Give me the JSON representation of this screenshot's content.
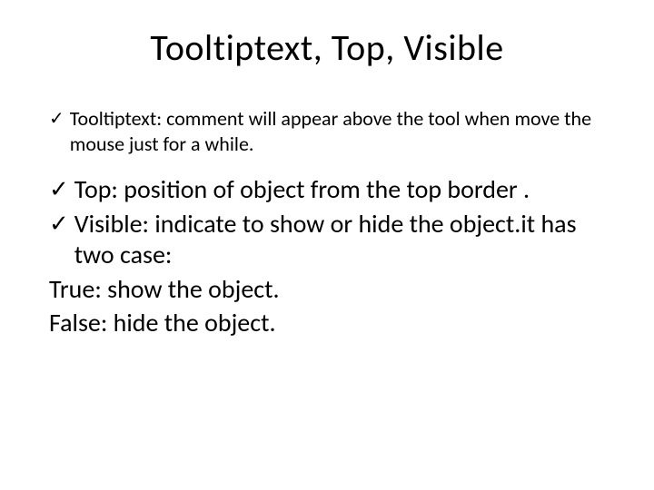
{
  "title": "Tooltiptext, Top, Visible",
  "items": {
    "tooltiptext": "Tooltiptext: comment will appear above the tool when move the mouse just for a while.",
    "top": "Top: position of object from the top border .",
    "visible": "Visible: indicate to show or hide the object.it has two case:"
  },
  "lines": {
    "true": "True: show the object.",
    "false": "False: hide the object."
  },
  "icons": {
    "check": "✓"
  }
}
